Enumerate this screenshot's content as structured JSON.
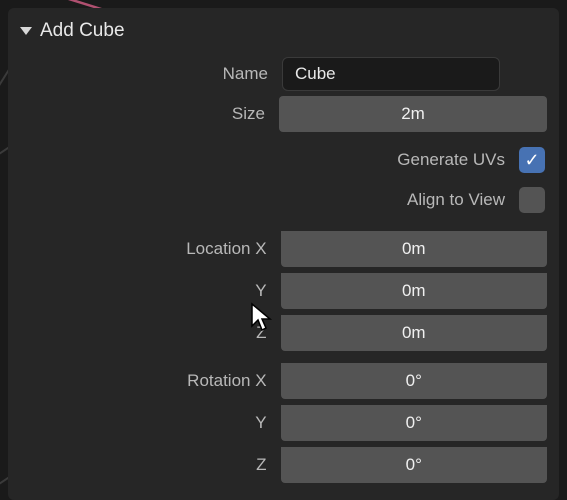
{
  "panel": {
    "title": "Add Cube"
  },
  "fields": {
    "name_label": "Name",
    "name_value": "Cube",
    "size_label": "Size",
    "size_value": "2m",
    "generate_uvs_label": "Generate UVs",
    "generate_uvs_checked": true,
    "align_view_label": "Align to View",
    "align_view_checked": false,
    "location_label": "Location X",
    "location": {
      "x": "0m",
      "y_label": "Y",
      "y": "0m",
      "z_label": "Z",
      "z": "0m"
    },
    "rotation_label": "Rotation X",
    "rotation": {
      "x": "0°",
      "y_label": "Y",
      "y": "0°",
      "z_label": "Z",
      "z": "0°"
    }
  }
}
